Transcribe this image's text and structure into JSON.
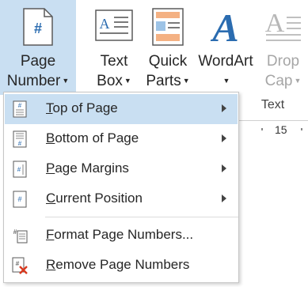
{
  "ribbon": {
    "page_number": {
      "line1": "Page",
      "line2": "Number"
    },
    "text_box": {
      "line1": "Text",
      "line2": "Box"
    },
    "quick_parts": {
      "line1": "Quick",
      "line2": "Parts"
    },
    "wordart": {
      "line1": "WordArt",
      "line2": ""
    },
    "drop_cap": {
      "line1": "Drop",
      "line2": "Cap"
    },
    "group_label": "Text"
  },
  "ruler": {
    "number": "15"
  },
  "menu": {
    "items": [
      {
        "label_first": "T",
        "label_rest": "op of Page",
        "icon": "top-of-page-icon",
        "has_submenu": true,
        "highlighted": true
      },
      {
        "label_first": "B",
        "label_rest": "ottom of Page",
        "icon": "bottom-of-page-icon",
        "has_submenu": true,
        "highlighted": false
      },
      {
        "label_first": "P",
        "label_rest": "age Margins",
        "icon": "page-margins-icon",
        "has_submenu": true,
        "highlighted": false
      },
      {
        "label_first": "C",
        "label_rest": "urrent Position",
        "icon": "current-position-icon",
        "has_submenu": true,
        "highlighted": false
      },
      {
        "label_first": "F",
        "label_rest": "ormat Page Numbers...",
        "icon": "format-page-numbers-icon",
        "has_submenu": false,
        "highlighted": false
      },
      {
        "label_first": "R",
        "label_rest": "emove Page Numbers",
        "icon": "remove-page-numbers-icon",
        "has_submenu": false,
        "highlighted": false
      }
    ]
  },
  "colors": {
    "highlight": "#c9dff2",
    "wordart_blue": "#2b6cb0",
    "remove_red": "#d9381e"
  }
}
